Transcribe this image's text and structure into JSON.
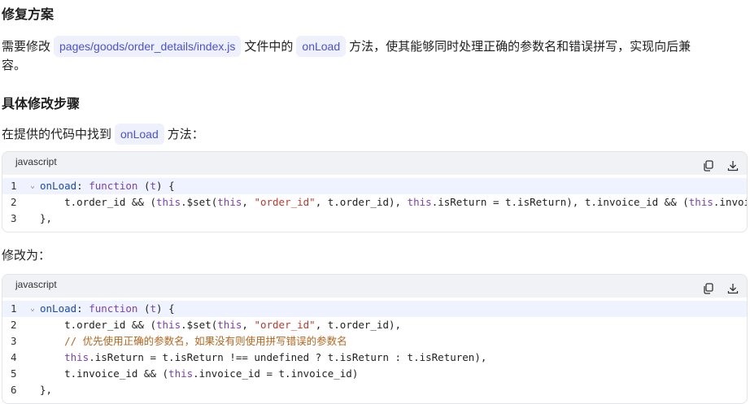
{
  "heading1": "修复方案",
  "para1": {
    "before": "需要修改",
    "file_chip": "pages/goods/order_details/index.js",
    "middle": "文件中的",
    "method_chip": "onLoad",
    "after_line1": "方法，使其能够同时处理正确的参数名和错误拼写，实现向后兼",
    "after_line2": "容。"
  },
  "heading2": "具体修改步骤",
  "para2": {
    "before": "在提供的代码中找到",
    "method_chip": "onLoad",
    "after": "方法："
  },
  "code1": {
    "language": "javascript",
    "lines": [
      {
        "n": "1",
        "tokens": [
          [
            "fn",
            "onLoad"
          ],
          [
            "src",
            ": "
          ],
          [
            "kw",
            "function"
          ],
          [
            "src",
            " ("
          ],
          [
            "kw",
            "t"
          ],
          [
            "src",
            ") {"
          ]
        ]
      },
      {
        "n": "2",
        "tokens": [
          [
            "src",
            "    t.order_id && ("
          ],
          [
            "kw",
            "this"
          ],
          [
            "src",
            ".$set("
          ],
          [
            "kw",
            "this"
          ],
          [
            "src",
            ", "
          ],
          [
            "str",
            "\"order_id\""
          ],
          [
            "src",
            ", t.order_id), "
          ],
          [
            "kw",
            "this"
          ],
          [
            "src",
            ".isReturn = t.isReturn), t.invoice_id && ("
          ],
          [
            "kw",
            "this"
          ],
          [
            "src",
            ".invoice_"
          ]
        ]
      },
      {
        "n": "3",
        "tokens": [
          [
            "src",
            "},"
          ]
        ]
      }
    ]
  },
  "para3": "修改为：",
  "code2": {
    "language": "javascript",
    "lines": [
      {
        "n": "1",
        "tokens": [
          [
            "fn",
            "onLoad"
          ],
          [
            "src",
            ": "
          ],
          [
            "kw",
            "function"
          ],
          [
            "src",
            " ("
          ],
          [
            "kw",
            "t"
          ],
          [
            "src",
            ") {"
          ]
        ]
      },
      {
        "n": "2",
        "tokens": [
          [
            "src",
            "    t.order_id && ("
          ],
          [
            "kw",
            "this"
          ],
          [
            "src",
            ".$set("
          ],
          [
            "kw",
            "this"
          ],
          [
            "src",
            ", "
          ],
          [
            "str",
            "\"order_id\""
          ],
          [
            "src",
            ", t.order_id),"
          ]
        ]
      },
      {
        "n": "3",
        "tokens": [
          [
            "cm",
            "    // 优先使用正确的参数名，如果没有则使用拼写错误的参数名"
          ]
        ]
      },
      {
        "n": "4",
        "tokens": [
          [
            "src",
            "    "
          ],
          [
            "kw",
            "this"
          ],
          [
            "src",
            ".isReturn = t.isReturn !== undefined ? t.isReturn : t.isReturen),"
          ]
        ]
      },
      {
        "n": "5",
        "tokens": [
          [
            "src",
            "    t.invoice_id && ("
          ],
          [
            "kw",
            "this"
          ],
          [
            "src",
            ".invoice_id = t.invoice_id)"
          ]
        ]
      },
      {
        "n": "6",
        "tokens": [
          [
            "src",
            "},"
          ]
        ]
      }
    ]
  },
  "icons": {
    "copy": "copy-icon",
    "download": "download-icon"
  }
}
